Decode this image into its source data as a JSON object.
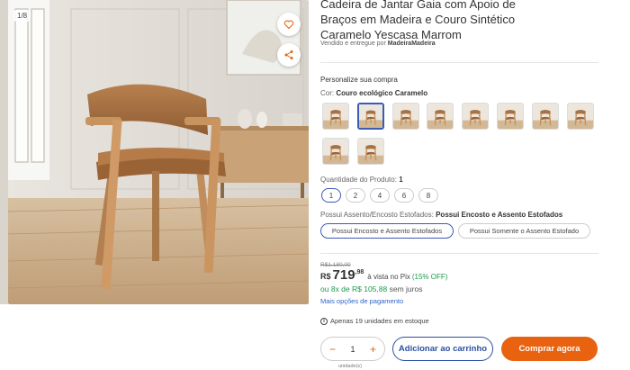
{
  "gallery": {
    "counter": "1/8",
    "main_image": "caramel-dining-chair-photo",
    "icons": {
      "favorite": "heart-icon",
      "share": "share-icon"
    }
  },
  "product": {
    "title": "Cadeira de Jantar Gaia com Apoio de Braços em Madeira e Couro Sintético Caramelo Yescasa Marrom",
    "seller_prefix": "Vendido e entregue por",
    "seller_name": "MadeiraMadeira"
  },
  "customize": {
    "heading": "Personalize sua compra",
    "color_label": "Cor:",
    "color_value": "Couro ecológico Caramelo",
    "swatch_count": 10,
    "selected_swatch": 2
  },
  "quantity": {
    "label": "Quantidade do Produto:",
    "value": "1",
    "options": [
      "1",
      "2",
      "4",
      "6",
      "8"
    ]
  },
  "seat": {
    "label": "Possui Assento/Encosto Estofados:",
    "value": "Possui Encosto e Assento Estofados",
    "options": [
      "Possui Encosto e Assento Estofados",
      "Possui Somente o Assento Estofado"
    ]
  },
  "pricing": {
    "old_price": "R$1.180,00",
    "currency": "R$",
    "price_int": "719",
    "price_cents": ",98",
    "pix_text": "à vista no Pix",
    "pix_discount": "(15% OFF)",
    "install_prefix": "ou",
    "install_value": "8x de R$ 105,88",
    "install_suffix": "sem juros",
    "payment_link": "Mais opções de pagamento"
  },
  "stock": {
    "text": "Apenas 19 unidades em estoque"
  },
  "purchase": {
    "minus": "−",
    "qty": "1",
    "plus": "+",
    "unit_label": "unidade(s)",
    "add_to_cart": "Adicionar ao carrinho",
    "buy_now": "Comprar agora"
  },
  "colors": {
    "accent_blue": "#3b5bb5",
    "cta_orange": "#e8620f",
    "pix_green": "#1a9b4d",
    "link_blue": "#2c62c8"
  }
}
